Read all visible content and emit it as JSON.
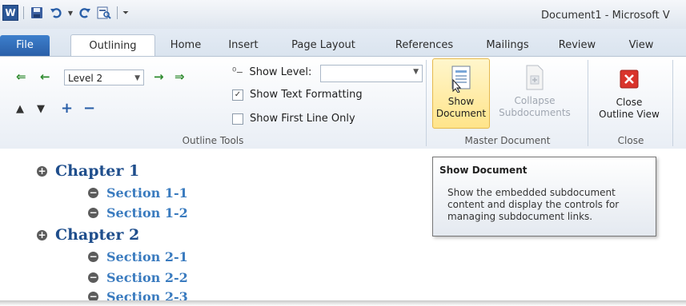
{
  "window": {
    "title": "Document1 - Microsoft V"
  },
  "qat": {
    "logo_letter": "W"
  },
  "tabs": [
    "File",
    "Outlining",
    "Home",
    "Insert",
    "Page Layout",
    "References",
    "Mailings",
    "Review",
    "View"
  ],
  "outline_tools": {
    "level_value": "Level 2",
    "show_level_label": "Show Level:",
    "show_level_value": "",
    "show_text_formatting_label": "Show Text Formatting",
    "show_text_formatting_checked": true,
    "show_first_line_only_label": "Show First Line Only",
    "show_first_line_only_checked": false,
    "group_label": "Outline Tools"
  },
  "master_document": {
    "show_document_line1": "Show",
    "show_document_line2": "Document",
    "collapse_line1": "Collapse",
    "collapse_line2": "Subdocuments",
    "group_label": "Master Document"
  },
  "close_group": {
    "close_line1": "Close",
    "close_line2": "Outline View",
    "group_label": "Close"
  },
  "outline": [
    {
      "kind": "chapter",
      "symbol": "+",
      "text": "Chapter 1"
    },
    {
      "kind": "section",
      "symbol": "−",
      "text": "Section 1-1"
    },
    {
      "kind": "section",
      "symbol": "−",
      "text": "Section 1-2"
    },
    {
      "kind": "chapter",
      "symbol": "+",
      "text": "Chapter 2"
    },
    {
      "kind": "section",
      "symbol": "−",
      "text": "Section 2-1"
    },
    {
      "kind": "section",
      "symbol": "−",
      "text": "Section 2-2"
    },
    {
      "kind": "section",
      "symbol": "−",
      "text": "Section 2-3"
    }
  ],
  "tooltip": {
    "title": "Show Document",
    "body": "Show the embedded subdocument content and display the controls for managing subdocument links."
  },
  "colors": {
    "accent": "#2a5fa8",
    "heading": "#1f4e8c",
    "subheading": "#3a7bbf",
    "hover": "#ffe48a"
  }
}
